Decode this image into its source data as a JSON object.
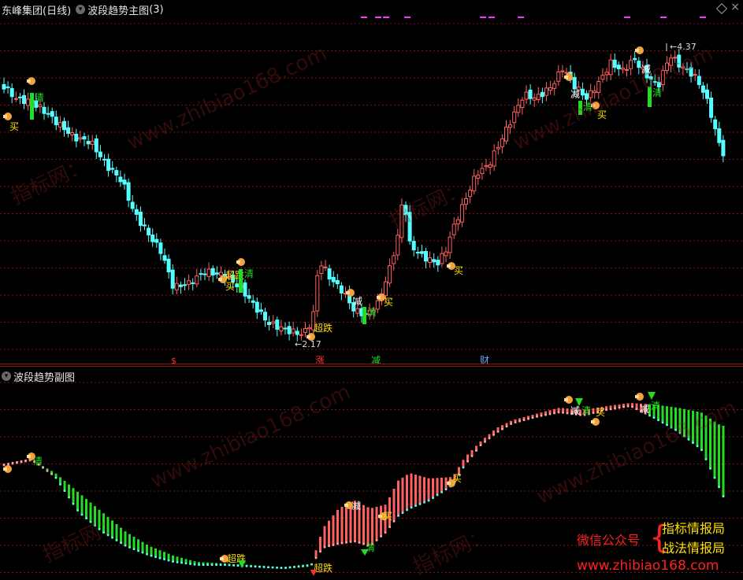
{
  "main": {
    "stock_name": "东峰集团",
    "period": "(日线)",
    "indicator_name": "波段趋势主图",
    "indicator_param": "(3)",
    "high_label": "4.37",
    "low_label": "2.17",
    "bottom_marks": [
      "$",
      "涨",
      "减",
      "财"
    ],
    "signals": [
      "买",
      "减",
      "清",
      "超跌"
    ]
  },
  "sub": {
    "indicator_name": "波段趋势副图"
  },
  "watermarks": [
    "www.zhibiao168.com",
    "指标网：",
    "www.zhibiao168.com",
    "指标网：",
    "www.zhibiao168.com",
    "指标网：",
    "www.zhibiao168.com",
    "指标网："
  ],
  "promo": {
    "wechat": "微信公众号",
    "line1": "指标情报局",
    "line2": "战法情报局",
    "url": "www.zhibiao168.com"
  },
  "colors": {
    "up": "#ff6060",
    "down": "#54ffff",
    "green": "#22dd22",
    "signal_text": "#ffe000",
    "grid": "#8a1010",
    "magenta": "#ff33ff"
  }
}
